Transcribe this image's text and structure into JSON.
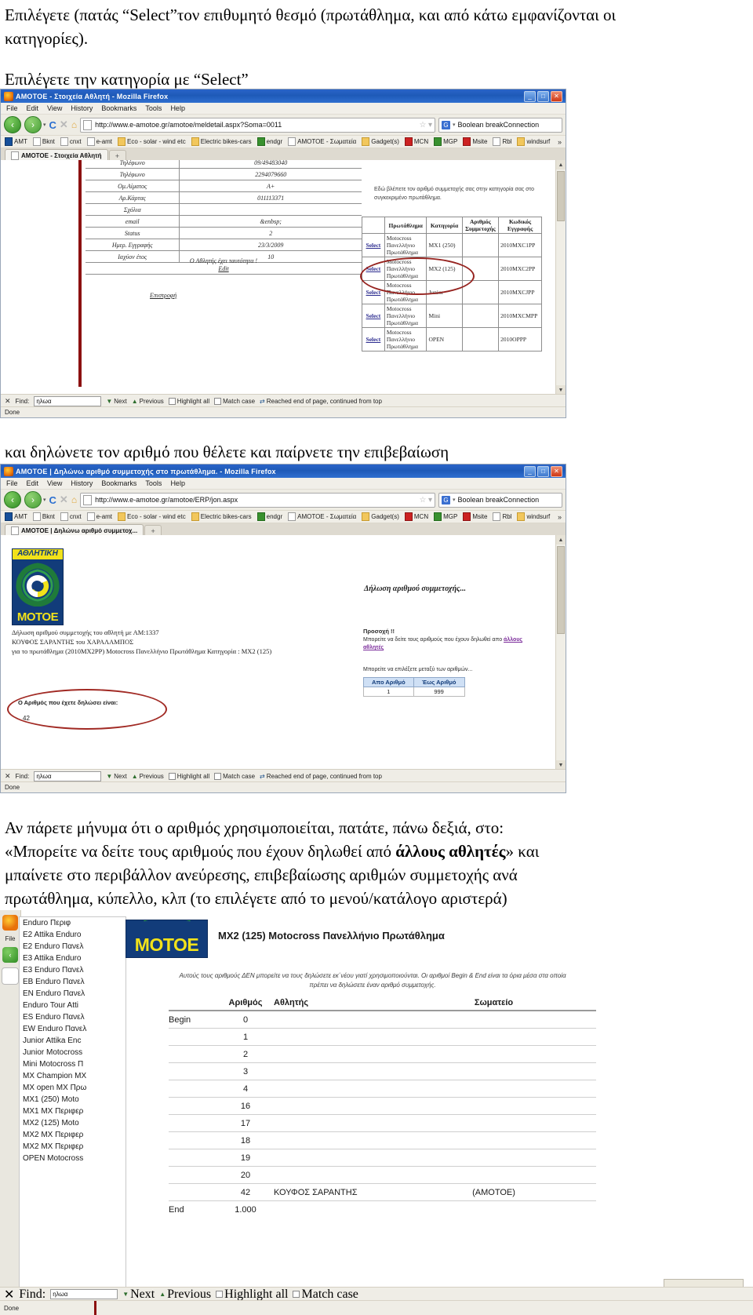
{
  "doc": {
    "para1": "Επιλέγετε (πατάς “Select”τον επιθυμητό θεσμό (πρωτάθλημα, και από κάτω εμφανίζονται οι κατηγορίες).",
    "para2": "Επιλέγετε την κατηγορία με “Select”",
    "para3": "και δηλώνετε τον αριθμό που θέλετε και παίρνετε την επιβεβαίωση",
    "para4_line1": "Αν πάρετε μήνυμα ότι ο αριθμός χρησιμοποιείται, πατάτε, πάνω δεξιά, στο:",
    "para4_line2a": "«Μπορείτε να δείτε τους αριθμούς που έχουν δηλωθεί από ",
    "para4_bold": "άλλους αθλητές",
    "para4_line2b": "» και",
    "para4_line3": "μπαίνετε στο περιβάλλον ανεύρεσης, επιβεβαίωσης αριθμών συμμετοχής ανά",
    "para4_line4": "πρωτάθλημα, κύπελλο, κλπ (το επιλέγετε από το μενού/κατάλογο αριστερά)"
  },
  "browser_common": {
    "menus": [
      "File",
      "Edit",
      "View",
      "History",
      "Bookmarks",
      "Tools",
      "Help"
    ],
    "nav": {
      "back_icon": "back-arrow-icon",
      "forward_icon": "forward-arrow-icon",
      "reload_icon": "reload-icon",
      "stop_icon": "stop-icon",
      "home_icon": "home-icon",
      "star_icon": "star-icon",
      "dropdown_icon": "chevron-down-icon"
    },
    "search_engine_label": "Boolean breakConnection",
    "bookmarks": [
      {
        "label": "AMT",
        "icon": "blue"
      },
      {
        "label": "Bknt",
        "icon": "page"
      },
      {
        "label": "cnxt",
        "icon": "page"
      },
      {
        "label": "e-amt",
        "icon": "page"
      },
      {
        "label": "Eco - solar - wind etc",
        "icon": "folder"
      },
      {
        "label": "Electric bikes-cars",
        "icon": "folder"
      },
      {
        "label": "endgr",
        "icon": "green"
      },
      {
        "label": "AMOTOE - Σωματεία",
        "icon": "page"
      },
      {
        "label": "Gadget(s)",
        "icon": "folder"
      },
      {
        "label": "MCN",
        "icon": "red"
      },
      {
        "label": "MGP",
        "icon": "green"
      },
      {
        "label": "Msite",
        "icon": "red"
      },
      {
        "label": "Rbl",
        "icon": "page"
      },
      {
        "label": "windsurf",
        "icon": "folder"
      }
    ],
    "bookmarks_overflow": "»",
    "findbar": {
      "close_icon": "close-icon",
      "find_label": "Find:",
      "find_value": "ηλωα",
      "next": "Next",
      "previous": "Previous",
      "highlight": "Highlight all",
      "match_case": "Match case",
      "reached": "Reached end of page, continued from top"
    },
    "status": "Done",
    "window_buttons": {
      "minimize": "_",
      "maximize": "□",
      "close": "✕"
    }
  },
  "browser1": {
    "title": "AMOTOE - Στοιχεία Αθλητή - Mozilla Firefox",
    "url": "http://www.e-amotoe.gr/amotoe/meldetail.aspx?Soma=0011",
    "tab_label": "AMOTOE - Στοιχεία Αθλητή",
    "newtab_icon": "plus-icon",
    "details": [
      {
        "key": "Τηλέφωνο",
        "value": "09/49483040"
      },
      {
        "key": "Τηλέφωνο",
        "value": "2294079660"
      },
      {
        "key": "Ομ.Αίματος",
        "value": "Α+"
      },
      {
        "key": "Αρ.Κάρτας",
        "value": "011113371"
      },
      {
        "key": "Σχόλια",
        "value": ""
      },
      {
        "key": "email",
        "value": "&enbsp;"
      },
      {
        "key": "Status",
        "value": "2"
      },
      {
        "key": "Ημερ. Εγγραφής",
        "value": "23/3/2009"
      },
      {
        "key": "Ιαχύον έτος",
        "value": "10"
      }
    ],
    "edit_link": "Edit",
    "identity_note": "Ο Αθλητής έχει ταυτότητα !",
    "back_link": "Επιστροφή",
    "hint": "Εδώ βλέπετε τον αριθμό συμμετοχής σας στην κατηγορία σας στο συγκεκριμένο πρωτάθλημα.",
    "table_headers": [
      "",
      "Πρωτάθλημα",
      "Κατηγορία",
      "Αριθμός Συμμετοχής",
      "Κωδικός Εγγραφής"
    ],
    "table_rows": [
      {
        "select": "Select",
        "champ": "Motocross Πανελλήνιο Πρωτάθλημα",
        "cat": "MX1 (250)",
        "num": "",
        "code": "2010MXC1PP"
      },
      {
        "select": "Select",
        "champ": "Motocross Πανελλήνιο Πρωτάθλημα",
        "cat": "MX2 (125)",
        "num": "",
        "code": "2010MXC2PP"
      },
      {
        "select": "Select",
        "champ": "Motocross Πανελλήνιο Πρωτάθλημα",
        "cat": "Junior",
        "num": "",
        "code": "2010MXCJPP"
      },
      {
        "select": "Select",
        "champ": "Motocross Πανελλήνιο Πρωτάθλημα",
        "cat": "Mini",
        "num": "",
        "code": "2010MXCMPP"
      },
      {
        "select": "Select",
        "champ": "Motocross Πανελλήνιο Πρωτάθλημα",
        "cat": "OPEN",
        "num": "",
        "code": "2010OPPP"
      }
    ]
  },
  "browser2": {
    "title": "AMOTOE | Δηλώνω αριθμό συμμετοχής στο πρωτάθλημα. - Mozilla Firefox",
    "url": "http://www.e-amotoe.gr/amotoe/ERP/jon.aspx",
    "tab_label": "AMOTOE | Δηλώνω αριθμό συμμετοχ...",
    "logo": {
      "top": "ΑΘΛΗΤΙΚΗ",
      "bottom": "MOTOE"
    },
    "line1": "Δήλωση αριθμού συμμετοχής του αθλητή με ΑΜ:1337",
    "line2": "ΚΟΥΦΟΣ ΣΑΡΑΝΤΗΣ του ΧΑΡΑΛΑΜΠΟΣ",
    "line3": "για το πρωτάθλημα (2010MX2PP) Motocross Πανελλήνιο Πρωτάθλημα Κατηγορία : MX2 (125)",
    "heading": "Δήλωση αριθμού συμμετοχής...",
    "warn_title": "Προσοχή !!",
    "warn_text": "Μπορείτε να δείτε τους αριθμούς που έχουν δηλωθεί απο ",
    "warn_link": "άλλους αθλητές",
    "range_intro": "Μπορείτε να επιλέξετε μεταξύ των αριθμών...",
    "range_headers": [
      "Απο Αριθμό",
      "Έως Αριθμό"
    ],
    "range_values": [
      "1",
      "999"
    ],
    "confirm_text": "Ο Αριθμός που έχετε δηλώσει είναι:",
    "confirm_number": "42"
  },
  "app3": {
    "sidebar_items": [
      "Enduro Περιφ",
      "E2 Attika Enduro",
      "E2 Enduro Πανελ",
      "E3 Attika Enduro",
      "E3 Enduro Πανελ",
      "EB Enduro Πανελ",
      "EN Enduro Πανελ",
      "Enduro Tour Atti",
      "ES Enduro Πανελ",
      "EW Enduro Πανελ",
      "Junior Attika Enc",
      "Junior Motocross",
      "Mini Motocross Π",
      "MX Champion MX",
      "MX open MX Πρω",
      "MX1 (250) Moto",
      "MX1 MX Περιφερ",
      "MX2 (125) Moto",
      "MX2 MX Περιφερ",
      "MX2 MX Περιφερ",
      "OPEN Motocross"
    ],
    "logo": {
      "bottom": "MOTOE"
    },
    "title": "MX2 (125) Motocross Πανελλήνιο Πρωτάθλημα",
    "note": "Αυτούς τους αριθμούς ΔΕΝ μπορείτε να τους δηλώσετε εκ΄νέου γιατί χρησιμοποιούνται. Οι αριθμοί Begin & End είναι τα όρια μέσα στα οποία πρέπει να δηλώσετε έναν αριθμό συμμετοχής.",
    "headers": [
      "",
      "Αριθμός",
      "Αθλητής",
      "Σωματείο"
    ],
    "rows": [
      {
        "label": "Begin",
        "num": "0",
        "athlete": "",
        "club": ""
      },
      {
        "label": "",
        "num": "1",
        "athlete": "",
        "club": ""
      },
      {
        "label": "",
        "num": "2",
        "athlete": "",
        "club": ""
      },
      {
        "label": "",
        "num": "3",
        "athlete": "",
        "club": ""
      },
      {
        "label": "",
        "num": "4",
        "athlete": "",
        "club": ""
      },
      {
        "label": "",
        "num": "16",
        "athlete": "",
        "club": ""
      },
      {
        "label": "",
        "num": "17",
        "athlete": "",
        "club": ""
      },
      {
        "label": "",
        "num": "18",
        "athlete": "",
        "club": ""
      },
      {
        "label": "",
        "num": "19",
        "athlete": "",
        "club": ""
      },
      {
        "label": "",
        "num": "20",
        "athlete": "",
        "club": ""
      },
      {
        "label": "",
        "num": "42",
        "athlete": "ΚΟΥΦΟΣ          ΣΑΡΑΝΤΗΣ",
        "club": "(AMOTOE)"
      },
      {
        "label": "End",
        "num": "1.000",
        "athlete": "",
        "club": ""
      }
    ],
    "menu": "File",
    "findbar": {
      "close_icon": "close-icon",
      "find_label": "Find:",
      "find_value": "ηλωα",
      "next": "Next",
      "previous": "Previous",
      "highlight": "Highlight all",
      "match_case": "Match case"
    },
    "status": "Done"
  }
}
